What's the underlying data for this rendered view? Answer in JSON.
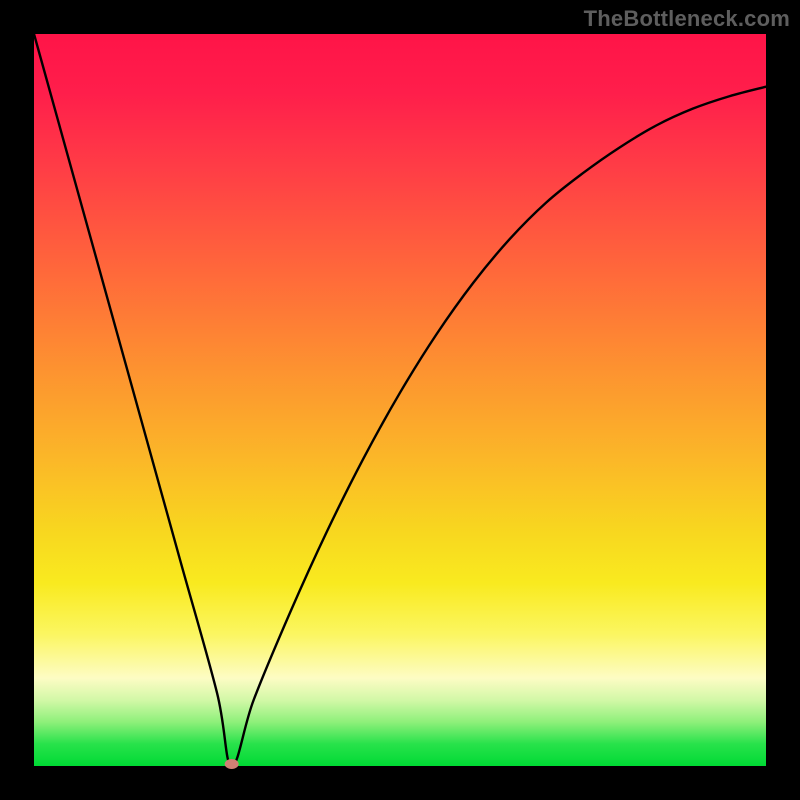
{
  "watermark": "TheBottleneck.com",
  "chart_data": {
    "type": "line",
    "title": "",
    "xlabel": "",
    "ylabel": "",
    "xlim": [
      0,
      100
    ],
    "ylim": [
      0,
      100
    ],
    "grid": false,
    "legend": false,
    "gradient_stops": [
      {
        "pos": 0,
        "color": "#ff1448"
      },
      {
        "pos": 8,
        "color": "#ff1e4b"
      },
      {
        "pos": 18,
        "color": "#ff3c46"
      },
      {
        "pos": 33,
        "color": "#ff6a3a"
      },
      {
        "pos": 46,
        "color": "#fd9330"
      },
      {
        "pos": 58,
        "color": "#fbb728"
      },
      {
        "pos": 68,
        "color": "#f8d71f"
      },
      {
        "pos": 75,
        "color": "#f9ea1f"
      },
      {
        "pos": 82,
        "color": "#fbf661"
      },
      {
        "pos": 88,
        "color": "#fdfcc4"
      },
      {
        "pos": 91,
        "color": "#d2f8a7"
      },
      {
        "pos": 94,
        "color": "#8ef07a"
      },
      {
        "pos": 97,
        "color": "#28e24b"
      },
      {
        "pos": 100,
        "color": "#00da34"
      }
    ],
    "series": [
      {
        "name": "bottleneck-curve",
        "x": [
          0,
          5,
          10,
          15,
          20,
          25,
          27,
          30,
          35,
          40,
          45,
          50,
          55,
          60,
          65,
          70,
          75,
          80,
          85,
          90,
          95,
          100
        ],
        "y": [
          100,
          82,
          64,
          46,
          28,
          10,
          0,
          9,
          21,
          32,
          42,
          51,
          59,
          66,
          72,
          77,
          81,
          84.5,
          87.5,
          89.8,
          91.5,
          92.8
        ]
      }
    ],
    "min_point": {
      "x": 27,
      "y": 0,
      "color": "#cf8074"
    }
  }
}
